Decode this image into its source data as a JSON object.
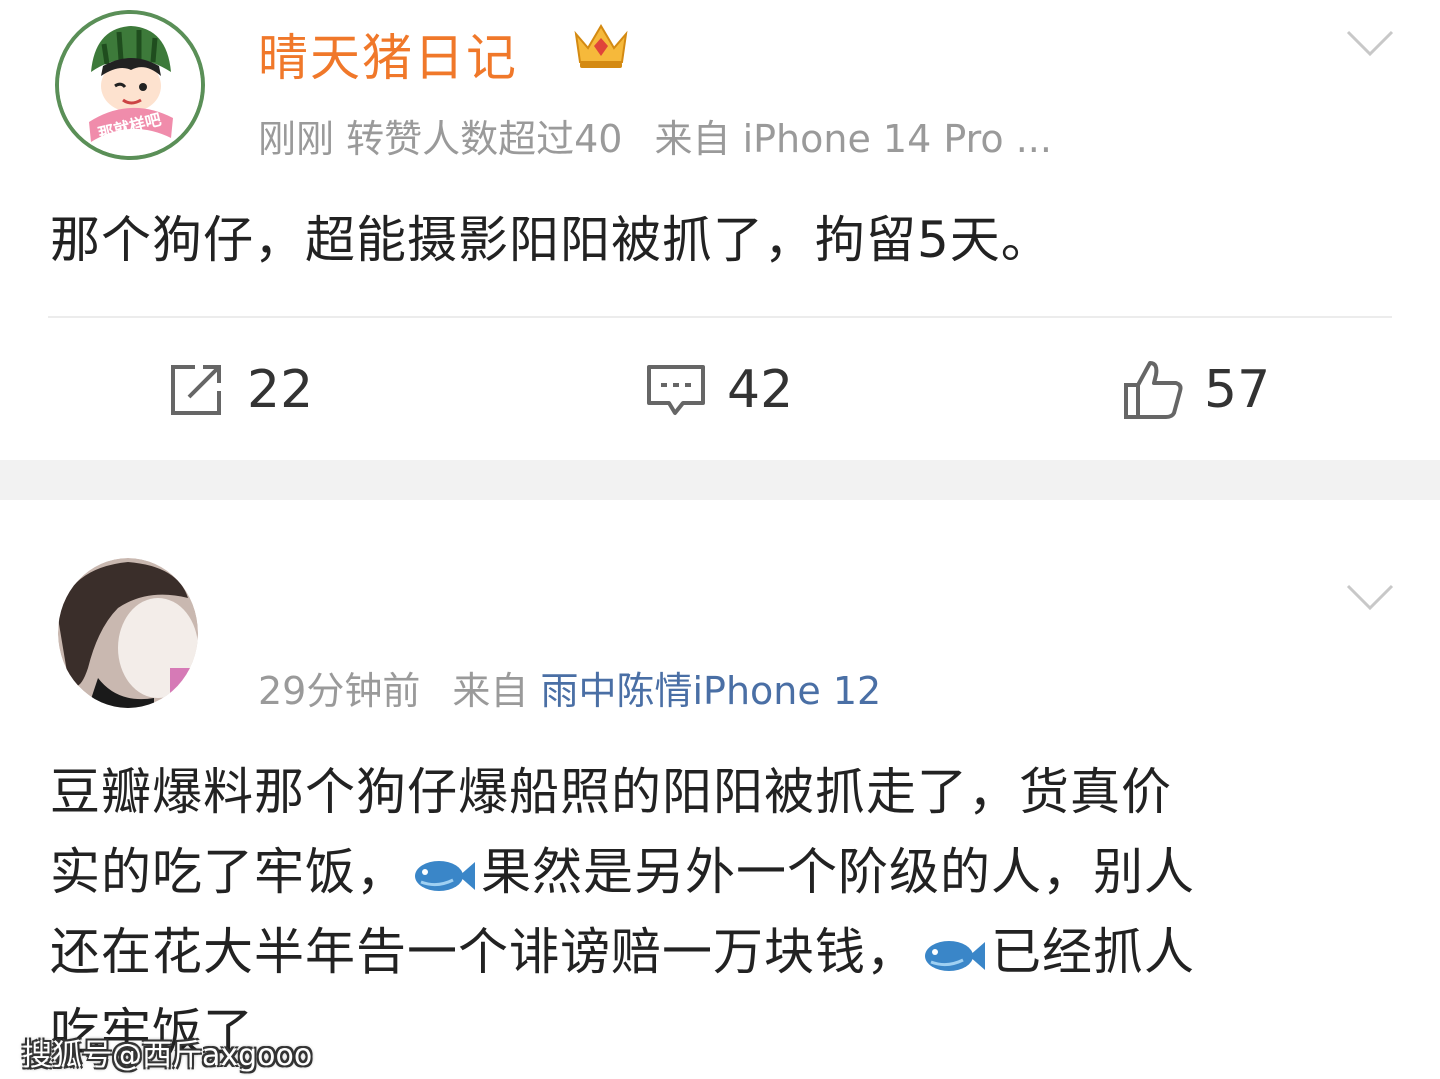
{
  "post1": {
    "username": "晴天猪日记",
    "time": "刚刚",
    "repost_info": "转赞人数超过40",
    "source_prefix": "来自",
    "source": "iPhone 14 Pro ...",
    "avatar_text": "那就样吧",
    "content": "那个狗仔，超能摄影阳阳被抓了，拘留5天。",
    "actions": {
      "reposts": "22",
      "comments": "42",
      "likes": "57"
    }
  },
  "post2": {
    "time": "29分钟前",
    "source_prefix": "来自",
    "source": "雨中陈情iPhone 12",
    "content": {
      "line1": "豆瓣爆料那个狗仔爆船照的阳阳被抓走了，货真价",
      "line2a": "实的吃了牢饭，",
      "line2b": "果然是另外一个阶级的人，别人",
      "line3a": "还在花大半年告一个诽谤赔一万块钱，",
      "line3b": "已经抓人",
      "line4": "吃牢饭了"
    }
  },
  "icons": {
    "repost": "repost-icon",
    "comment": "comment-icon",
    "like": "thumbs-up-icon",
    "more": "chevron-down-icon",
    "fish": "fish-emoji-icon",
    "badge": "crown-badge-icon"
  },
  "colors": {
    "username": "#f0782a",
    "link": "#4a6fa5",
    "meta": "#9a9a9a"
  },
  "watermark": "搜狐号@西斤axgooo"
}
